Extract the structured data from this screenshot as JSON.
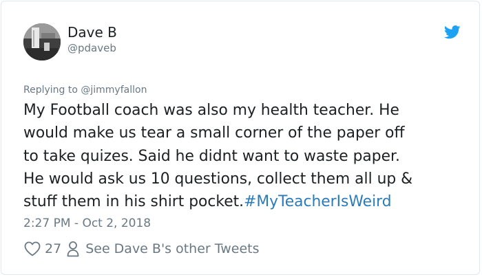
{
  "tweet": {
    "author": {
      "name": "Dave B",
      "handle": "@pdaveb"
    },
    "replying_to": "Replying to @jimmyfallon",
    "text_lines": [
      "My Football coach was also my health teacher. He",
      "would make us tear a small corner of the paper off",
      "to take quizes. Said he didnt want to waste paper.",
      "He would ask us 10 questions, collect them all up &",
      "stuff them in his shirt pocket."
    ],
    "hashtag": "#MyTeacherIsWeird",
    "timestamp": "2:27 PM - Oct 2, 2018",
    "likes": "27",
    "other_tweets_link": "See Dave B's other Tweets"
  },
  "colors": {
    "text": "#1c2022",
    "secondary": "#697882",
    "link": "#2b7bb9",
    "twitter_blue": "#1da1f2",
    "border": "#e1e8ed"
  },
  "icons": {
    "brand": "twitter-bird-icon",
    "like": "heart-icon",
    "profile": "person-icon"
  }
}
